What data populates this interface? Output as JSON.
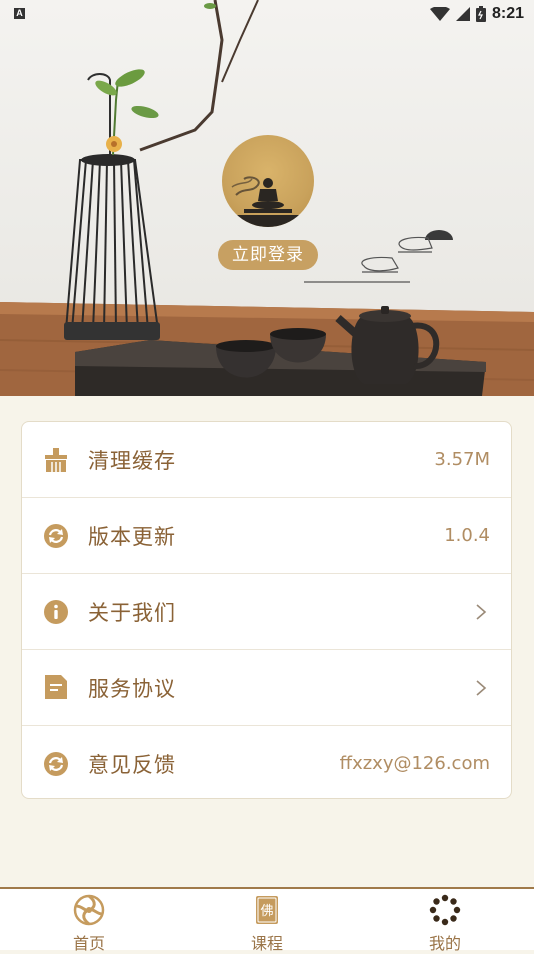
{
  "status_bar": {
    "time": "8:21",
    "left_badge": "A"
  },
  "hero": {
    "login_label": "立即登录"
  },
  "settings": [
    {
      "id": "clear-cache",
      "label": "清理缓存",
      "value": "3.57M",
      "icon": "broom-icon"
    },
    {
      "id": "version-update",
      "label": "版本更新",
      "value": "1.0.4",
      "icon": "refresh-icon"
    },
    {
      "id": "about-us",
      "label": "关于我们",
      "value": "",
      "icon": "info-icon",
      "chevron": true
    },
    {
      "id": "service-agreement",
      "label": "服务协议",
      "value": "",
      "icon": "document-icon",
      "chevron": true
    },
    {
      "id": "feedback",
      "label": "意见反馈",
      "value": "ffxzxy@126.com",
      "icon": "refresh-icon"
    }
  ],
  "bottom_nav": [
    {
      "label": "首页",
      "icon": "dharma-wheel-icon"
    },
    {
      "label": "课程",
      "icon": "buddha-book-icon"
    },
    {
      "label": "我的",
      "icon": "prayer-beads-icon"
    }
  ],
  "colors": {
    "accent": "#c7a062",
    "label": "#8a6236",
    "icon": "#c59b5e",
    "nav_border": "#a07a4a"
  }
}
